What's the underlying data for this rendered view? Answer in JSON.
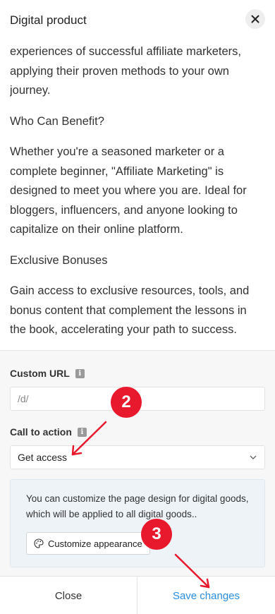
{
  "header": {
    "title": "Digital product",
    "close_icon": "close-icon"
  },
  "description": {
    "paragraphs": [
      "experiences of successful affiliate marketers, applying their proven methods to your own journey.",
      "Who Can Benefit?",
      "Whether you're a seasoned marketer or a complete beginner, \"Affiliate Marketing\" is designed to meet you where you are. Ideal for bloggers, influencers, and anyone looking to capitalize on their online platform.",
      "Exclusive Bonuses",
      "Gain access to exclusive resources, tools, and bonus content that complement the lessons in the book, accelerating your path to success."
    ]
  },
  "settings": {
    "custom_url": {
      "label": "Custom URL",
      "value": "/d/"
    },
    "call_to_action": {
      "label": "Call to action",
      "selected": "Get access"
    },
    "info": {
      "text": "You can customize the page design for digital goods, which will be applied to all digital goods..",
      "button_label": "Customize appearance",
      "button_icon": "palette-icon"
    }
  },
  "footer": {
    "close_label": "Close",
    "save_label": "Save changes"
  },
  "annotations": {
    "badge_2": "2",
    "badge_3": "3",
    "color": "#e8192c"
  },
  "colors": {
    "accent": "#2a8de0",
    "settings_bg": "#f7f7f8",
    "info_bg": "#eef3f7"
  }
}
